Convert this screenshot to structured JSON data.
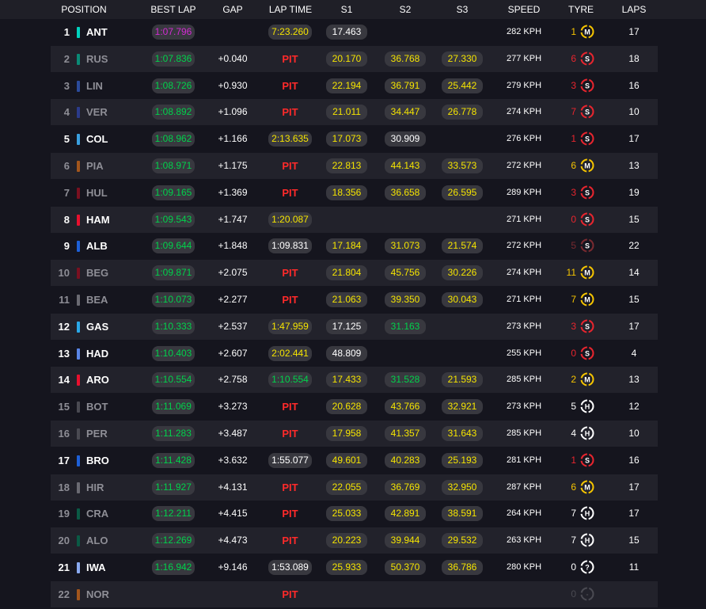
{
  "headers": {
    "position": "POSITION",
    "best_lap": "BEST LAP",
    "gap": "GAP",
    "lap_time": "LAP TIME",
    "s1": "S1",
    "s2": "S2",
    "s3": "S3",
    "speed": "SPEED",
    "tyre": "TYRE",
    "laps": "LAPS"
  },
  "colors": {
    "background": "#15151e",
    "row_alt": "#22222b",
    "pill": "#38383f",
    "green": "#00d24b",
    "purple": "#d32bd3",
    "yellow": "#f5e400",
    "pit_red": "#ff2a2a",
    "soft_red": "#e8252e",
    "medium_yellow": "#f5c400",
    "hard_white": "#ffffff",
    "dim_text": "#8e8e96"
  },
  "rows": [
    {
      "pos": "1",
      "code": "ANT",
      "team_color": "#00d2be",
      "dim": false,
      "best": "1:07.796",
      "best_purple": true,
      "gap": "",
      "lap": "7:23.260",
      "lap_color": "yellow",
      "s1": "17.463",
      "s1_c": "white",
      "s2": "",
      "s2_c": "",
      "s3": "",
      "s3_c": "",
      "speed": "282 KPH",
      "tyre_age": "1",
      "tyre": "M",
      "laps": "17"
    },
    {
      "pos": "2",
      "code": "RUS",
      "team_color": "#0a8a75",
      "dim": true,
      "best": "1:07.836",
      "best_purple": false,
      "gap": "+0.040",
      "lap": "PIT",
      "lap_color": "pit",
      "s1": "20.170",
      "s1_c": "yellow",
      "s2": "36.768",
      "s2_c": "yellow",
      "s3": "27.330",
      "s3_c": "yellow",
      "speed": "277 KPH",
      "tyre_age": "6",
      "tyre": "S",
      "laps": "18"
    },
    {
      "pos": "3",
      "code": "LIN",
      "team_color": "#2b4b9b",
      "dim": true,
      "best": "1:08.726",
      "best_purple": false,
      "gap": "+0.930",
      "lap": "PIT",
      "lap_color": "pit",
      "s1": "22.194",
      "s1_c": "yellow",
      "s2": "36.791",
      "s2_c": "yellow",
      "s3": "25.442",
      "s3_c": "yellow",
      "speed": "279 KPH",
      "tyre_age": "3",
      "tyre": "S",
      "laps": "16"
    },
    {
      "pos": "4",
      "code": "VER",
      "team_color": "#2b3b8b",
      "dim": true,
      "best": "1:08.892",
      "best_purple": false,
      "gap": "+1.096",
      "lap": "PIT",
      "lap_color": "pit",
      "s1": "21.011",
      "s1_c": "yellow",
      "s2": "34.447",
      "s2_c": "yellow",
      "s3": "26.778",
      "s3_c": "yellow",
      "speed": "274 KPH",
      "tyre_age": "7",
      "tyre": "S",
      "laps": "10"
    },
    {
      "pos": "5",
      "code": "COL",
      "team_color": "#3aa0e0",
      "dim": false,
      "best": "1:08.962",
      "best_purple": false,
      "gap": "+1.166",
      "lap": "2:13.635",
      "lap_color": "yellow",
      "s1": "17.073",
      "s1_c": "yellow",
      "s2": "30.909",
      "s2_c": "white",
      "s3": "",
      "s3_c": "",
      "speed": "276 KPH",
      "tyre_age": "1",
      "tyre": "S",
      "laps": "17"
    },
    {
      "pos": "6",
      "code": "PIA",
      "team_color": "#a3561c",
      "dim": true,
      "best": "1:08.971",
      "best_purple": false,
      "gap": "+1.175",
      "lap": "PIT",
      "lap_color": "pit",
      "s1": "22.813",
      "s1_c": "yellow",
      "s2": "44.143",
      "s2_c": "yellow",
      "s3": "33.573",
      "s3_c": "yellow",
      "speed": "272 KPH",
      "tyre_age": "6",
      "tyre": "M",
      "laps": "13"
    },
    {
      "pos": "7",
      "code": "HUL",
      "team_color": "#7a1020",
      "dim": true,
      "best": "1:09.165",
      "best_purple": false,
      "gap": "+1.369",
      "lap": "PIT",
      "lap_color": "pit",
      "s1": "18.356",
      "s1_c": "yellow",
      "s2": "36.658",
      "s2_c": "yellow",
      "s3": "26.595",
      "s3_c": "yellow",
      "speed": "289 KPH",
      "tyre_age": "3",
      "tyre": "S",
      "laps": "19"
    },
    {
      "pos": "8",
      "code": "HAM",
      "team_color": "#e8102e",
      "dim": false,
      "best": "1:09.543",
      "best_purple": false,
      "gap": "+1.747",
      "lap": "1:20.087",
      "lap_color": "yellow",
      "s1": "",
      "s1_c": "",
      "s2": "",
      "s2_c": "",
      "s3": "",
      "s3_c": "",
      "speed": "271 KPH",
      "tyre_age": "0",
      "tyre": "S",
      "laps": "15"
    },
    {
      "pos": "9",
      "code": "ALB",
      "team_color": "#1e60d8",
      "dim": false,
      "best": "1:09.644",
      "best_purple": false,
      "gap": "+1.848",
      "lap": "1:09.831",
      "lap_color": "white",
      "s1": "17.184",
      "s1_c": "yellow",
      "s2": "31.073",
      "s2_c": "yellow",
      "s3": "21.574",
      "s3_c": "yellow",
      "speed": "272 KPH",
      "tyre_age": "5",
      "tyre": "S",
      "laps": "22"
    },
    {
      "pos": "10",
      "code": "BEG",
      "team_color": "#7a1020",
      "dim": true,
      "best": "1:09.871",
      "best_purple": false,
      "gap": "+2.075",
      "lap": "PIT",
      "lap_color": "pit",
      "s1": "21.804",
      "s1_c": "yellow",
      "s2": "45.756",
      "s2_c": "yellow",
      "s3": "30.226",
      "s3_c": "yellow",
      "speed": "274 KPH",
      "tyre_age": "11",
      "tyre": "M",
      "laps": "14"
    },
    {
      "pos": "11",
      "code": "BEA",
      "team_color": "#6a6a72",
      "dim": true,
      "best": "1:10.073",
      "best_purple": false,
      "gap": "+2.277",
      "lap": "PIT",
      "lap_color": "pit",
      "s1": "21.063",
      "s1_c": "yellow",
      "s2": "39.350",
      "s2_c": "yellow",
      "s3": "30.043",
      "s3_c": "yellow",
      "speed": "271 KPH",
      "tyre_age": "7",
      "tyre": "M",
      "laps": "15"
    },
    {
      "pos": "12",
      "code": "GAS",
      "team_color": "#2aa8e8",
      "dim": false,
      "best": "1:10.333",
      "best_purple": false,
      "gap": "+2.537",
      "lap": "1:47.959",
      "lap_color": "yellow",
      "s1": "17.125",
      "s1_c": "white",
      "s2": "31.163",
      "s2_c": "green",
      "s3": "",
      "s3_c": "",
      "speed": "273 KPH",
      "tyre_age": "3",
      "tyre": "S",
      "laps": "17"
    },
    {
      "pos": "13",
      "code": "HAD",
      "team_color": "#5a86e8",
      "dim": false,
      "best": "1:10.403",
      "best_purple": false,
      "gap": "+2.607",
      "lap": "2:02.441",
      "lap_color": "yellow",
      "s1": "48.809",
      "s1_c": "white",
      "s2": "",
      "s2_c": "",
      "s3": "",
      "s3_c": "",
      "speed": "255 KPH",
      "tyre_age": "0",
      "tyre": "S",
      "laps": "4"
    },
    {
      "pos": "14",
      "code": "ARO",
      "team_color": "#e8102e",
      "dim": false,
      "best": "1:10.554",
      "best_purple": false,
      "gap": "+2.758",
      "lap": "1:10.554",
      "lap_color": "green",
      "s1": "17.433",
      "s1_c": "yellow",
      "s2": "31.528",
      "s2_c": "green",
      "s3": "21.593",
      "s3_c": "yellow",
      "speed": "285 KPH",
      "tyre_age": "2",
      "tyre": "M",
      "laps": "13"
    },
    {
      "pos": "15",
      "code": "BOT",
      "team_color": "#4a4a52",
      "dim": true,
      "best": "1:11.069",
      "best_purple": false,
      "gap": "+3.273",
      "lap": "PIT",
      "lap_color": "pit",
      "s1": "20.628",
      "s1_c": "yellow",
      "s2": "43.766",
      "s2_c": "yellow",
      "s3": "32.921",
      "s3_c": "yellow",
      "speed": "273 KPH",
      "tyre_age": "5",
      "tyre": "H",
      "laps": "12"
    },
    {
      "pos": "16",
      "code": "PER",
      "team_color": "#4a4a52",
      "dim": true,
      "best": "1:11.283",
      "best_purple": false,
      "gap": "+3.487",
      "lap": "PIT",
      "lap_color": "pit",
      "s1": "17.958",
      "s1_c": "yellow",
      "s2": "41.357",
      "s2_c": "yellow",
      "s3": "31.643",
      "s3_c": "yellow",
      "speed": "285 KPH",
      "tyre_age": "4",
      "tyre": "H",
      "laps": "10"
    },
    {
      "pos": "17",
      "code": "BRO",
      "team_color": "#1e60d8",
      "dim": false,
      "best": "1:11.428",
      "best_purple": false,
      "gap": "+3.632",
      "lap": "1:55.077",
      "lap_color": "white",
      "s1": "49.601",
      "s1_c": "yellow",
      "s2": "40.283",
      "s2_c": "yellow",
      "s3": "25.193",
      "s3_c": "yellow",
      "speed": "281 KPH",
      "tyre_age": "1",
      "tyre": "S",
      "laps": "16"
    },
    {
      "pos": "18",
      "code": "HIR",
      "team_color": "#6a6a72",
      "dim": true,
      "best": "1:11.927",
      "best_purple": false,
      "gap": "+4.131",
      "lap": "PIT",
      "lap_color": "pit",
      "s1": "22.055",
      "s1_c": "yellow",
      "s2": "36.769",
      "s2_c": "yellow",
      "s3": "32.950",
      "s3_c": "yellow",
      "speed": "287 KPH",
      "tyre_age": "6",
      "tyre": "M",
      "laps": "17"
    },
    {
      "pos": "19",
      "code": "CRA",
      "team_color": "#0a5a45",
      "dim": true,
      "best": "1:12.211",
      "best_purple": false,
      "gap": "+4.415",
      "lap": "PIT",
      "lap_color": "pit",
      "s1": "25.033",
      "s1_c": "yellow",
      "s2": "42.891",
      "s2_c": "yellow",
      "s3": "38.591",
      "s3_c": "yellow",
      "speed": "264 KPH",
      "tyre_age": "7",
      "tyre": "H",
      "laps": "17"
    },
    {
      "pos": "20",
      "code": "ALO",
      "team_color": "#0a5a45",
      "dim": true,
      "best": "1:12.269",
      "best_purple": false,
      "gap": "+4.473",
      "lap": "PIT",
      "lap_color": "pit",
      "s1": "20.223",
      "s1_c": "yellow",
      "s2": "39.944",
      "s2_c": "yellow",
      "s3": "29.532",
      "s3_c": "yellow",
      "speed": "263 KPH",
      "tyre_age": "7",
      "tyre": "H",
      "laps": "15"
    },
    {
      "pos": "21",
      "code": "IWA",
      "team_color": "#8aaaf0",
      "dim": false,
      "best": "1:16.942",
      "best_purple": false,
      "gap": "+9.146",
      "lap": "1:53.089",
      "lap_color": "white",
      "s1": "25.933",
      "s1_c": "yellow",
      "s2": "50.370",
      "s2_c": "yellow",
      "s3": "36.786",
      "s3_c": "yellow",
      "speed": "280 KPH",
      "tyre_age": "0",
      "tyre": "?",
      "laps": "11"
    },
    {
      "pos": "22",
      "code": "NOR",
      "team_color": "#a3561c",
      "dim": true,
      "best": "",
      "best_purple": false,
      "gap": "",
      "lap": "PIT",
      "lap_color": "pit",
      "s1": "",
      "s1_c": "",
      "s2": "",
      "s2_c": "",
      "s3": "",
      "s3_c": "",
      "speed": "",
      "tyre_age": "0",
      "tyre": "-",
      "laps": ""
    }
  ]
}
